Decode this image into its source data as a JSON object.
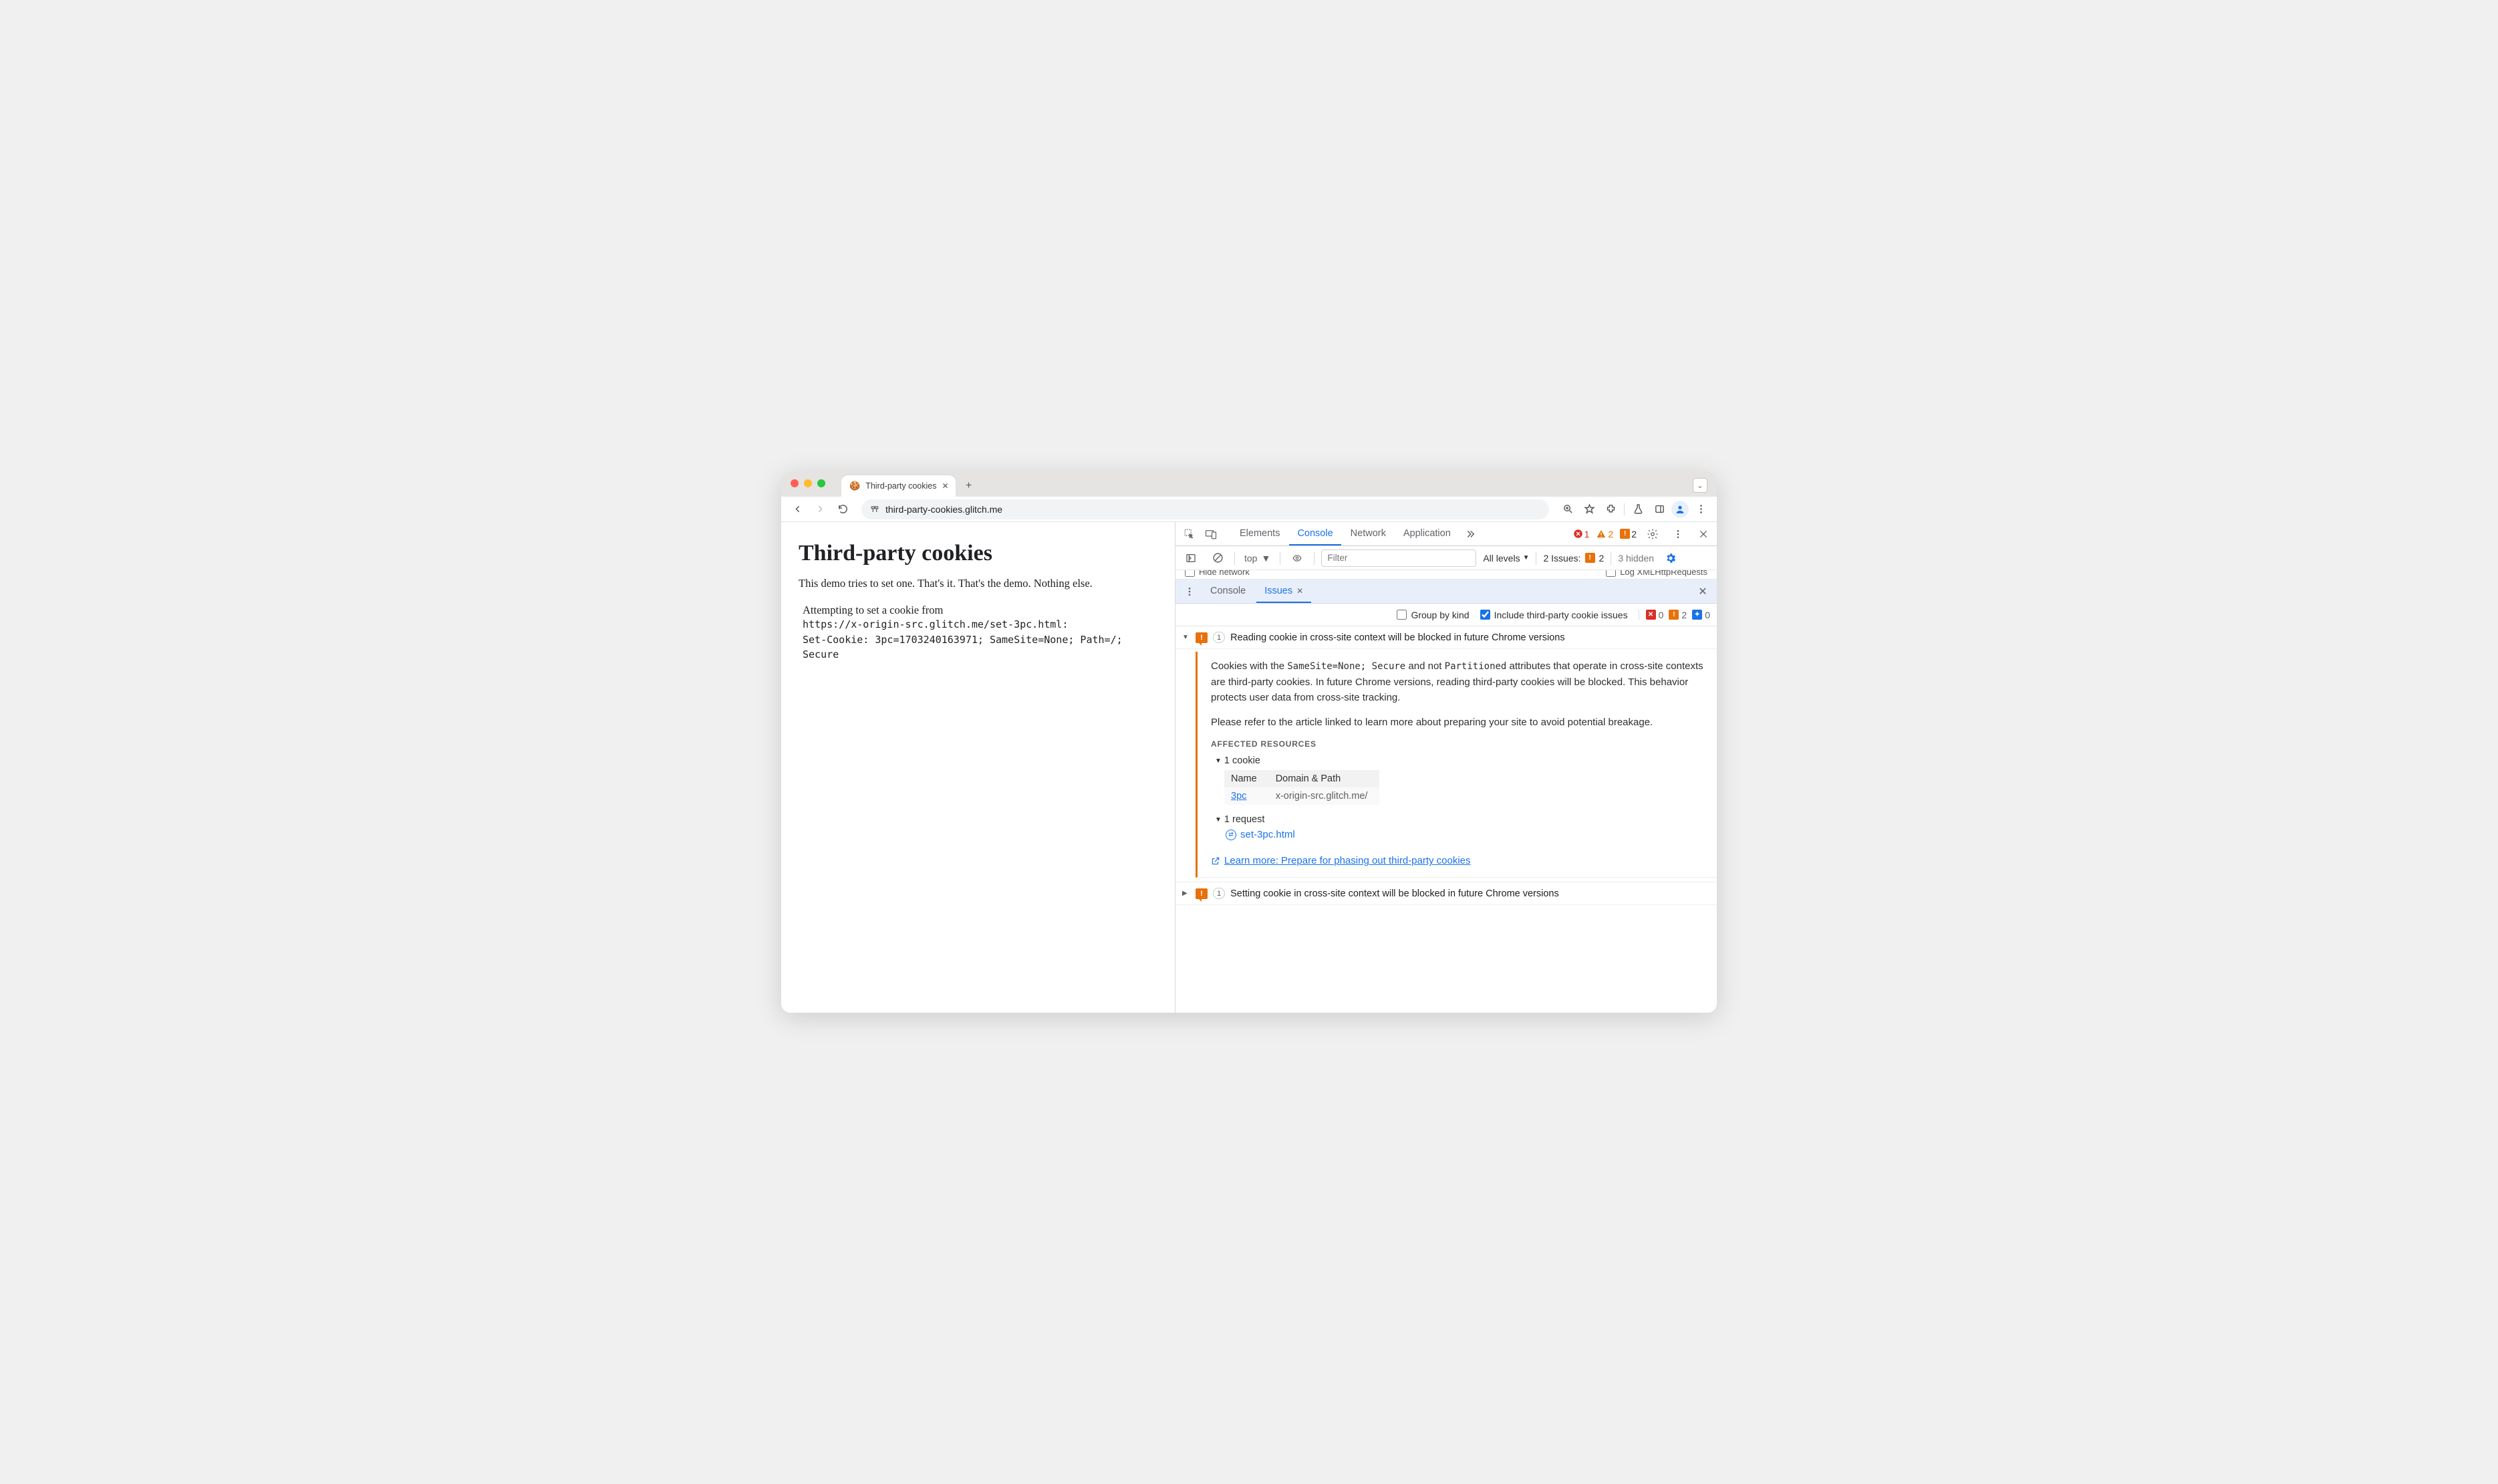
{
  "browser": {
    "tab_title": "Third-party cookies",
    "url": "third-party-cookies.glitch.me"
  },
  "page": {
    "h1": "Third-party cookies",
    "intro": "This demo tries to set one. That's it. That's the demo. Nothing else.",
    "attempt_line": "Attempting to set a cookie from",
    "attempt_url": "https://x-origin-src.glitch.me/set-3pc.html:",
    "set_cookie": "Set-Cookie: 3pc=1703240163971; SameSite=None; Path=/; Secure"
  },
  "devtools": {
    "tabs": {
      "elements": "Elements",
      "console": "Console",
      "network": "Network",
      "application": "Application"
    },
    "status": {
      "errors": "1",
      "warnings": "2",
      "issues": "2"
    },
    "consolebar": {
      "context": "top",
      "filter_placeholder": "Filter",
      "levels": "All levels",
      "issues_label": "2 Issues:",
      "issues_count": "2",
      "hidden": "3 hidden"
    },
    "peek": {
      "hide_network": "Hide network",
      "log_xhr": "Log XMLHttpRequests"
    },
    "drawer": {
      "console": "Console",
      "issues": "Issues"
    },
    "issuesbar": {
      "group": "Group by kind",
      "include": "Include third-party cookie issues",
      "red": "0",
      "orange": "2",
      "blue": "0"
    }
  },
  "issues": [
    {
      "count": "1",
      "title": "Reading cookie in cross-site context will be blocked in future Chrome versions",
      "expanded": true,
      "body": {
        "para1_a": "Cookies with the ",
        "code1": "SameSite=None; Secure",
        "para1_b": " and not ",
        "code2": "Partitioned",
        "para1_c": " attributes that operate in cross-site contexts are third-party cookies. In future Chrome versions, reading third-party cookies will be blocked. This behavior protects user data from cross-site tracking.",
        "para2": "Please refer to the article linked to learn more about preparing your site to avoid potential breakage.",
        "affected_label": "Affected Resources",
        "cookies_toggle": "1 cookie",
        "cookie_table": {
          "head_name": "Name",
          "head_domain": "Domain & Path",
          "name": "3pc",
          "domain": "x-origin-src.glitch.me/"
        },
        "requests_toggle": "1 request",
        "request_link": "set-3pc.html",
        "learn_more": "Learn more: Prepare for phasing out third-party cookies"
      }
    },
    {
      "count": "1",
      "title": "Setting cookie in cross-site context will be blocked in future Chrome versions",
      "expanded": false
    }
  ]
}
